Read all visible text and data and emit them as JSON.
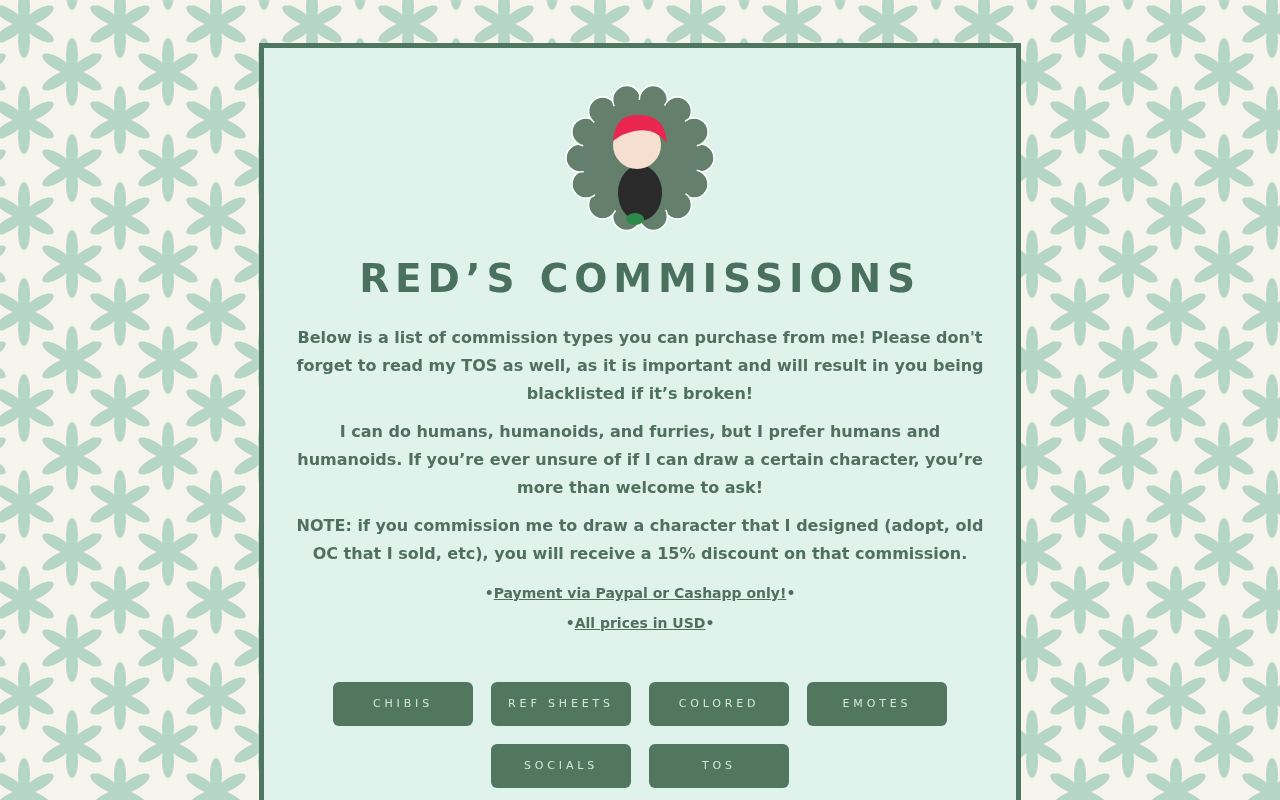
{
  "title": "RED’S COMMISSIONS",
  "paragraphs": [
    "Below is a list of commission types you can purchase from me! Please don't forget to read my TOS as well, as it is important and will result in you being blacklisted if it’s broken!",
    "I can do humans, humanoids, and furries, but I prefer humans and humanoids. If you’re ever unsure of if I can draw a certain character, you’re more than welcome to ask!",
    "NOTE: if you commission me to draw a character that I designed (adopt, old OC that I sold, etc), you will receive a 15% discount on that commission."
  ],
  "notes": [
    {
      "before": "•",
      "link": "Payment via Paypal or Cashapp only!",
      "after": "•"
    },
    {
      "before": "•",
      "link": "All prices in USD",
      "after": "•"
    }
  ],
  "buttons": [
    "CHIBIS",
    "REF SHEETS",
    "COLORED",
    "EMOTES",
    "SOCIALS",
    "TOS"
  ]
}
